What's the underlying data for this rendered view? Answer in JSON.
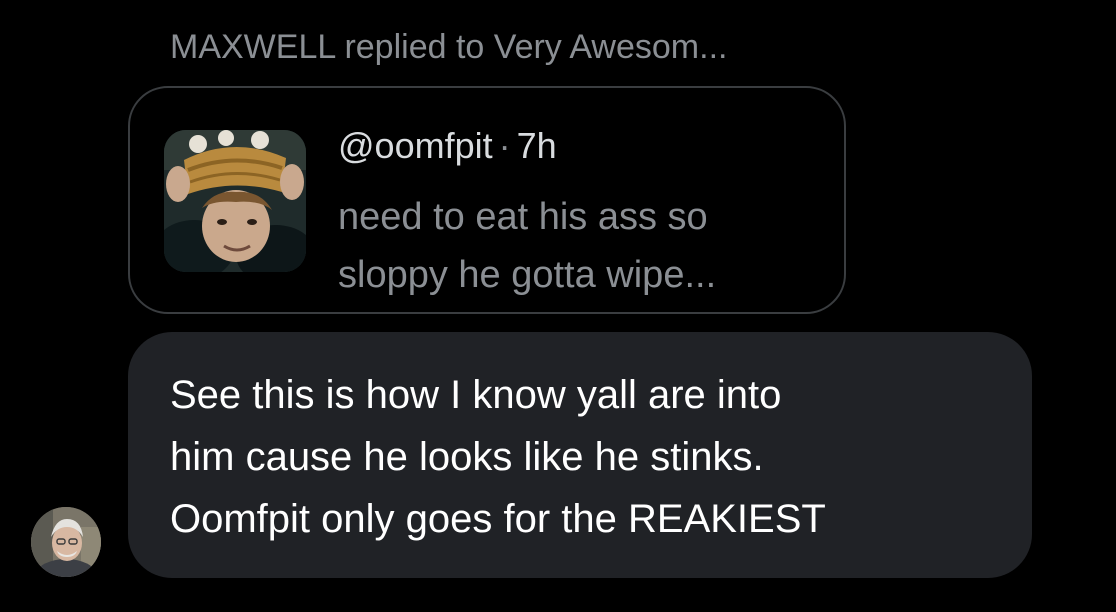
{
  "reply_context": {
    "text": "MAXWELL replied to Very Awesom..."
  },
  "quoted_post": {
    "avatar_icon": "quoted-user-avatar",
    "handle": "@oomfpit",
    "separator": "·",
    "time": "7h",
    "text_lines": [
      "need to eat his ass so",
      "sloppy he gotta wipe..."
    ]
  },
  "message": {
    "text_lines": [
      "See this is how I know yall are into",
      "him cause he looks like he stinks.",
      "Oomfpit only goes for the REAKIEST"
    ]
  },
  "sender": {
    "avatar_icon": "sender-avatar"
  },
  "colors": {
    "background": "#000000",
    "bubble": "#202226",
    "muted_text": "#8b8f94",
    "border": "#3a3d40"
  }
}
